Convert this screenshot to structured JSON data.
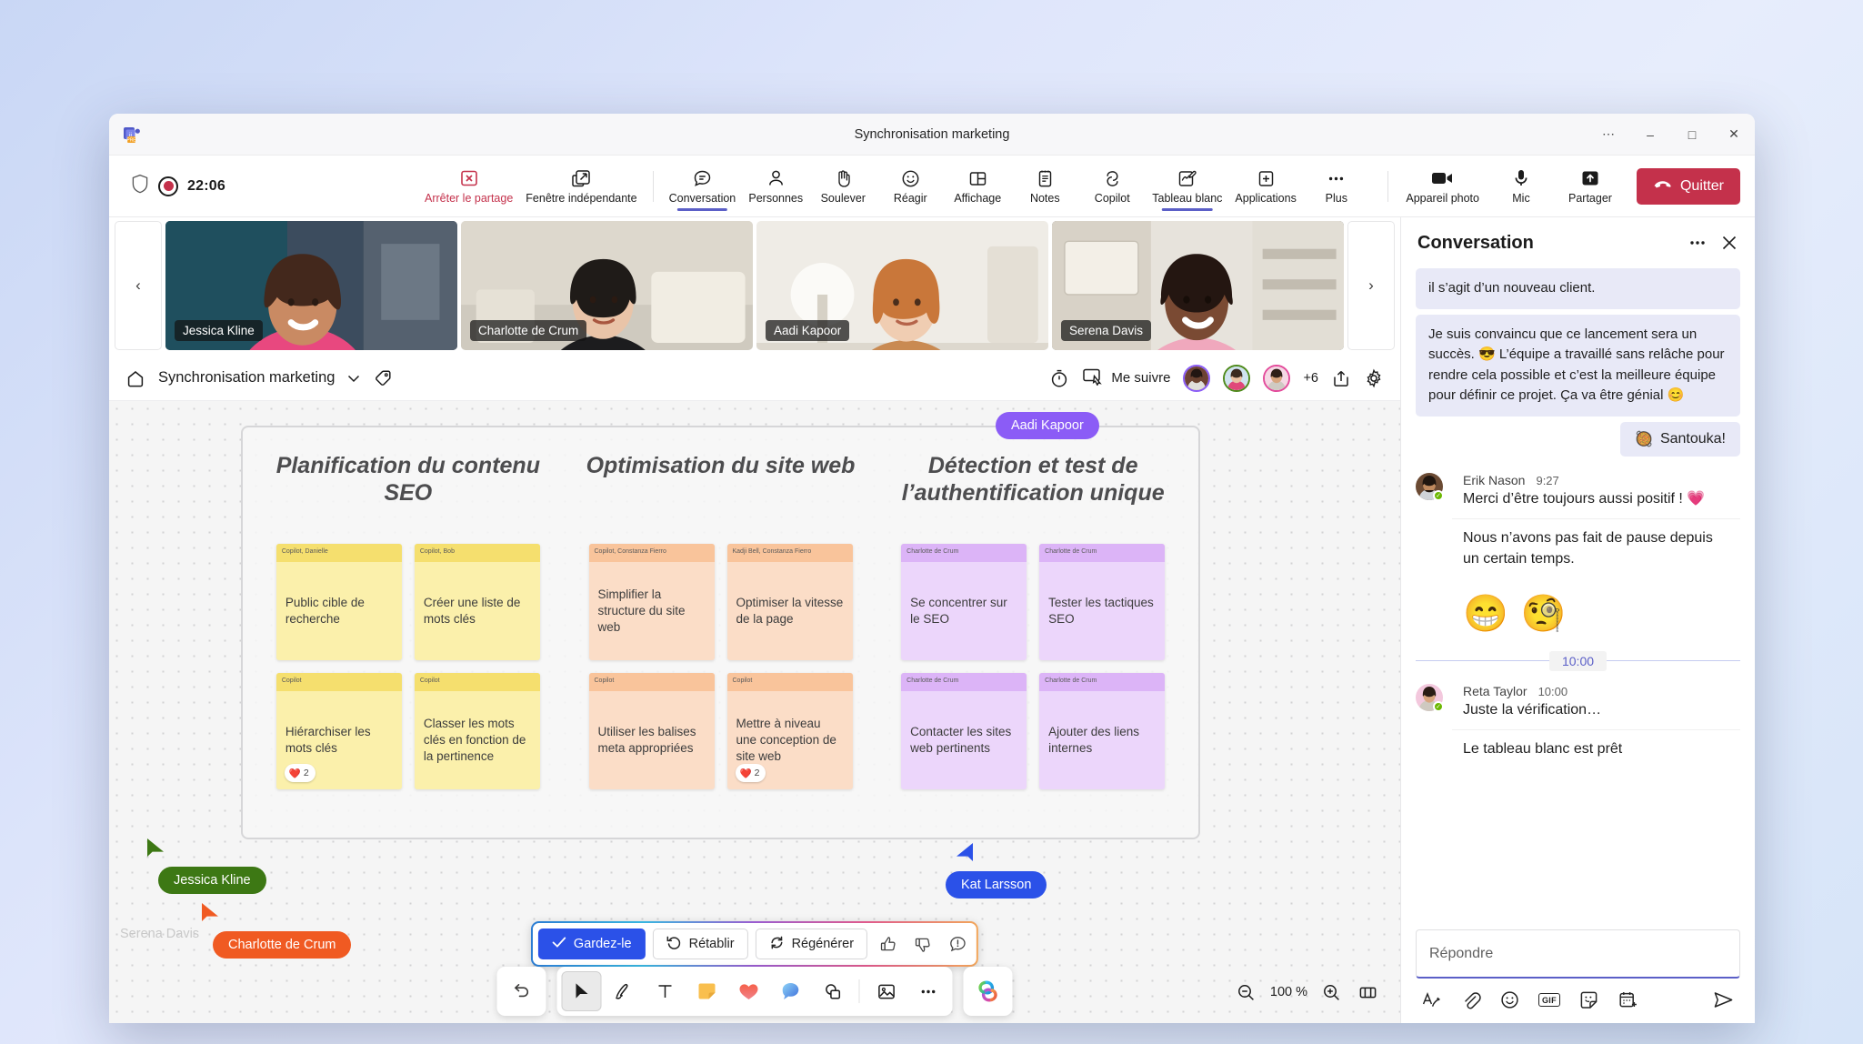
{
  "window": {
    "title": "Synchronisation marketing",
    "app_icon": "teams-logo-icon",
    "more_label": "⋯",
    "minimize_label": "–",
    "maximize_label": "□",
    "close_label": "✕"
  },
  "meeting_toolbar": {
    "shield_icon": "shield-icon",
    "record_time": "22:06",
    "stop_share": {
      "label": "Arrêter le partage",
      "icon": "stop-share-icon"
    },
    "popout": {
      "label": "Fenêtre indépendante",
      "icon": "pop-out-icon"
    },
    "items": [
      {
        "label": "Conversation",
        "icon": "chat-icon",
        "active": true
      },
      {
        "label": "Personnes",
        "icon": "people-icon",
        "active": false
      },
      {
        "label": "Soulever",
        "icon": "raise-hand-icon",
        "active": false
      },
      {
        "label": "Réagir",
        "icon": "react-icon",
        "active": false
      },
      {
        "label": "Affichage",
        "icon": "view-icon",
        "active": false
      },
      {
        "label": "Notes",
        "icon": "notes-icon",
        "active": false
      },
      {
        "label": "Copilot",
        "icon": "copilot-icon",
        "active": false
      },
      {
        "label": "Tableau blanc",
        "icon": "whiteboard-icon",
        "active": true
      },
      {
        "label": "Applications",
        "icon": "apps-plus-icon",
        "active": false
      },
      {
        "label": "Plus",
        "icon": "more-dots-icon",
        "active": false
      }
    ],
    "right_items": [
      {
        "label": "Appareil photo",
        "icon": "camera-icon"
      },
      {
        "label": "Mic",
        "icon": "microphone-icon"
      },
      {
        "label": "Partager",
        "icon": "share-screen-icon"
      }
    ],
    "leave_button": {
      "label": "Quitter",
      "icon": "hang-up-icon",
      "color": "#c4314b"
    }
  },
  "filmstrip": {
    "prev_label": "‹",
    "next_label": "›",
    "tiles": [
      {
        "name": "Jessica Kline",
        "speaking": false
      },
      {
        "name": "Charlotte de Crum",
        "speaking": false
      },
      {
        "name": "Aadi Kapoor",
        "speaking": false
      },
      {
        "name": "Serena Davis",
        "speaking": true
      }
    ]
  },
  "whiteboard_header": {
    "home_icon": "home-icon",
    "title": "Synchronisation marketing",
    "chevron": "⌄",
    "tag_icon": "tag-icon",
    "timer_icon": "timer-icon",
    "follow_icon": "follow-me-icon",
    "follow_label": "Me suivre",
    "overflow_count": "+6",
    "share_icon": "share-board-icon",
    "settings_icon": "gear-icon"
  },
  "board": {
    "columns": [
      {
        "heading": "Planification du contenu SEO",
        "notes": [
          {
            "author": "Copilot, Danielle",
            "text": "Public cible de recherche",
            "color": "yellow",
            "reaction": null
          },
          {
            "author": "Copilot, Bob",
            "text": "Créer une liste de mots clés",
            "color": "yellow",
            "reaction": null
          },
          {
            "author": "Copilot",
            "text": "Hiérarchiser les mots clés",
            "color": "yellow",
            "reaction": {
              "emoji": "❤️",
              "count": "2"
            }
          },
          {
            "author": "Copilot",
            "text": "Classer les mots clés en fonction de la pertinence",
            "color": "yellow",
            "reaction": null
          }
        ]
      },
      {
        "heading": "Optimisation du site web",
        "notes": [
          {
            "author": "Copilot, Constanza Fierro",
            "text": "Simplifier la structure du site web",
            "color": "peach",
            "reaction": null
          },
          {
            "author": "Kadji Bell, Constanza Fierro",
            "text": "Optimiser la vitesse de la page",
            "color": "peach",
            "reaction": null
          },
          {
            "author": "Copilot",
            "text": "Utiliser les balises meta appropriées",
            "color": "peach",
            "reaction": null
          },
          {
            "author": "Copilot",
            "text": "Mettre à niveau une conception de site web",
            "color": "peach",
            "reaction": {
              "emoji": "❤️",
              "count": "2"
            }
          }
        ]
      },
      {
        "heading": "Détection et test de l’authentification unique",
        "notes": [
          {
            "author": "Charlotte de Crum",
            "text": "Se concentrer sur le SEO",
            "color": "purple",
            "reaction": null
          },
          {
            "author": "Charlotte de Crum",
            "text": "Tester les tactiques SEO",
            "color": "purple",
            "reaction": null
          },
          {
            "author": "Charlotte de Crum",
            "text": "Contacter les sites web pertinents",
            "color": "purple",
            "reaction": null
          },
          {
            "author": "Charlotte de Crum",
            "text": "Ajouter des liens internes",
            "color": "purple",
            "reaction": null
          }
        ]
      }
    ],
    "cursors": [
      {
        "name": "Jessica Kline",
        "color": "#3d7814"
      },
      {
        "name": "Charlotte de Crum",
        "color": "#f05a22"
      },
      {
        "name": "Aadi Kapoor",
        "color": "#8b5cf6"
      },
      {
        "name": "Kat Larsson",
        "color": "#2b51e8"
      }
    ],
    "ghost_label": "Serena Davis"
  },
  "copilot_bar": {
    "keep": {
      "label": "Gardez-le",
      "icon": "check-icon"
    },
    "undo": {
      "label": "Rétablir",
      "icon": "undo-icon"
    },
    "regenerate": {
      "label": "Régénérer",
      "icon": "refresh-icon"
    },
    "thumbs_up_icon": "thumbs-up-icon",
    "thumbs_down_icon": "thumbs-down-icon",
    "feedback_icon": "feedback-icon"
  },
  "whiteboard_tools": {
    "undo_icon": "undo-arrow-icon",
    "tools": [
      {
        "icon": "cursor-select-icon",
        "selected": true
      },
      {
        "icon": "pen-icon",
        "selected": false
      },
      {
        "icon": "text-icon",
        "selected": false
      },
      {
        "icon": "sticky-note-icon",
        "selected": false
      },
      {
        "icon": "heart-reaction-icon",
        "selected": false
      },
      {
        "icon": "speech-bubble-icon",
        "selected": false
      },
      {
        "icon": "shapes-icon",
        "selected": false
      },
      {
        "icon": "image-icon",
        "selected": false
      },
      {
        "icon": "more-dots-icon",
        "selected": false
      }
    ],
    "copilot_icon": "copilot-rainbow-icon",
    "zoom_out_icon": "zoom-out-icon",
    "zoom_level": "100 %",
    "zoom_in_icon": "zoom-in-icon",
    "fit_icon": "fit-to-screen-icon"
  },
  "chat": {
    "title": "Conversation",
    "more_icon": "more-dots-icon",
    "close_icon": "close-icon",
    "messages": [
      {
        "type": "outgoing",
        "text": "il s’agit d’un nouveau client."
      },
      {
        "type": "outgoing",
        "text": "Je suis convaincu que ce lancement sera un succès. 😎 L’équipe a travaillé sans relâche pour rendre cela possible et c’est la meilleure équipe pour définir ce projet. Ça va être génial 😊"
      },
      {
        "type": "sticker",
        "emoji": "🥘",
        "text": "Santouka!"
      },
      {
        "type": "incoming",
        "name": "Erik Nason",
        "time": "9:27",
        "text": "Merci d’être toujours aussi positif ! 💗",
        "continuation": "Nous n’avons pas fait de pause depuis un certain temps."
      },
      {
        "type": "emoji-row",
        "emojis": [
          "😁",
          "🧐"
        ]
      },
      {
        "type": "divider",
        "label": "10:00"
      },
      {
        "type": "incoming",
        "name": "Reta Taylor",
        "time": "10:00",
        "text": "Juste la vérification…",
        "continuation": "Le tableau blanc est prêt"
      }
    ],
    "compose": {
      "placeholder": "Répondre",
      "tools": [
        {
          "icon": "format-text-icon"
        },
        {
          "icon": "attach-icon"
        },
        {
          "icon": "emoji-icon"
        },
        {
          "icon": "gif-icon",
          "label": "GIF"
        },
        {
          "icon": "sticker-icon"
        },
        {
          "icon": "schedule-icon"
        }
      ],
      "send_icon": "send-icon"
    }
  }
}
